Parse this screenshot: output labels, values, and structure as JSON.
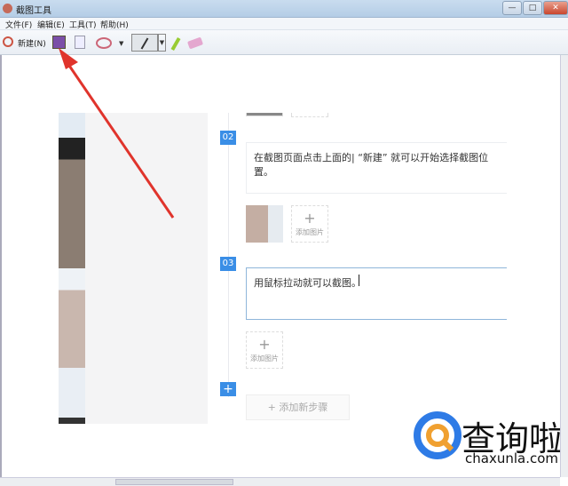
{
  "window": {
    "title": "截图工具",
    "min": "—",
    "max": "□",
    "close": "✕"
  },
  "menu": [
    "文件(F)",
    "编辑(E)",
    "工具(T)",
    "帮助(H)"
  ],
  "toolbar": {
    "new_label": "新建(N)"
  },
  "steps": [
    {
      "num": "02",
      "text": "在截图页面点击上面的| “新建” 就可以开始选择截图位置。",
      "add_image": "添加图片"
    },
    {
      "num": "03",
      "text": "用鼠标拉动就可以截图。",
      "add_image": "添加图片"
    }
  ],
  "add_step": {
    "plus": "+",
    "label": "+ 添加新步骤"
  },
  "watermark": {
    "brand": "查询啦",
    "url": "chaxunla.com"
  },
  "colors": {
    "accent": "#3a8ee6",
    "arrow": "#e0342c"
  }
}
